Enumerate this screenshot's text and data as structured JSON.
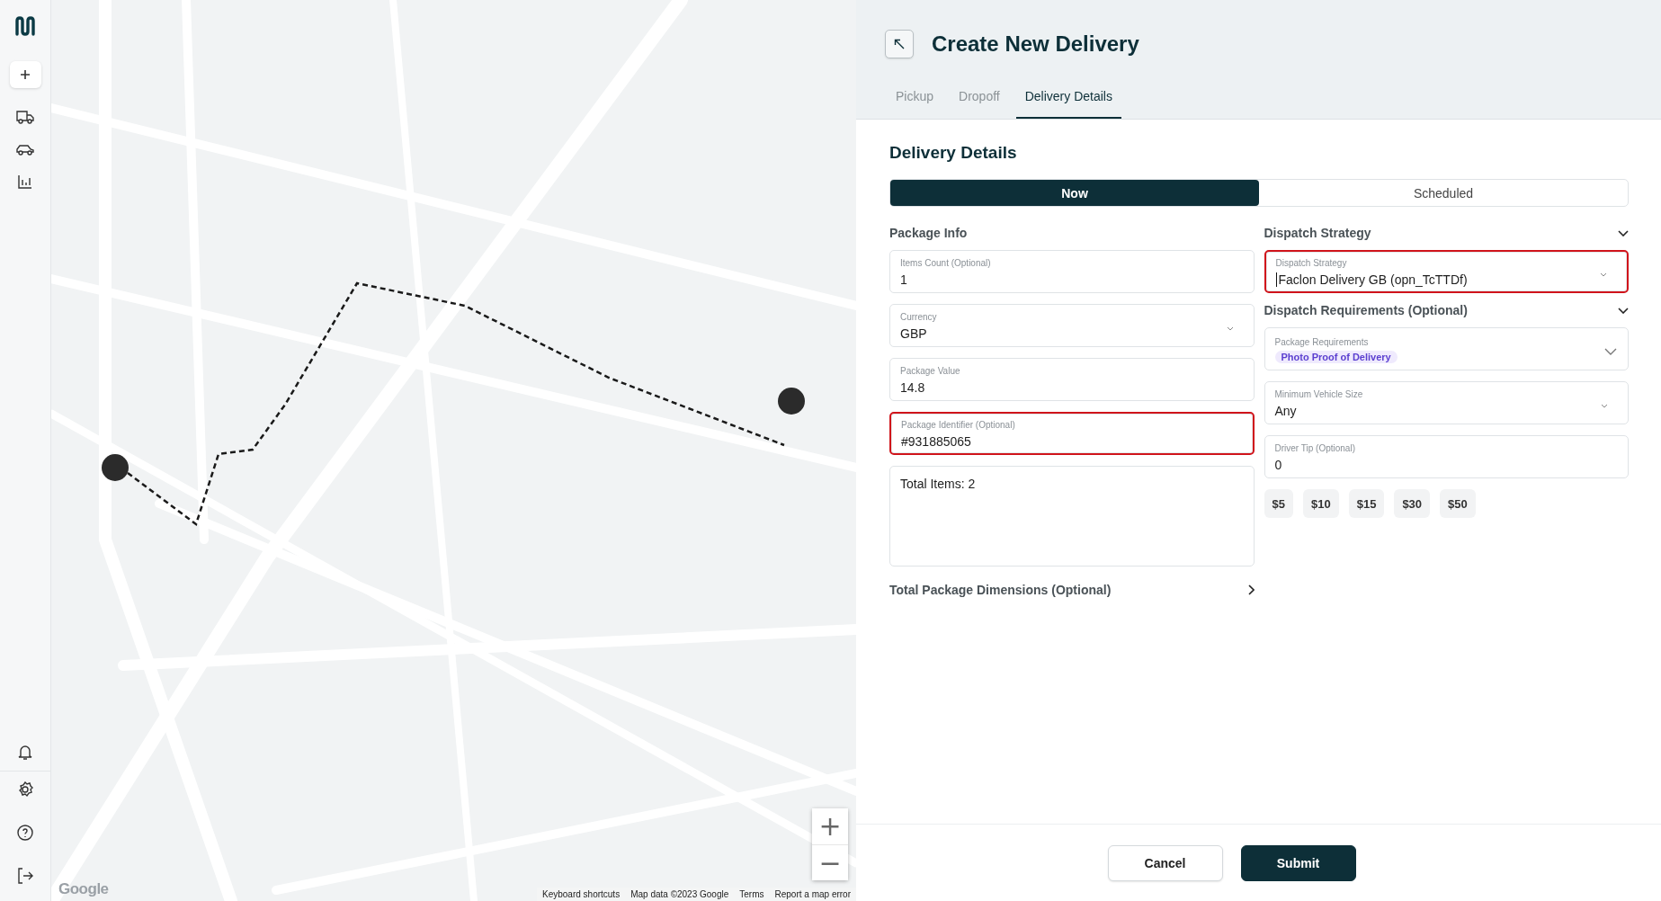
{
  "map": {
    "zoom_in": "+",
    "zoom_out": "−",
    "logo": "Google",
    "footer_links": [
      "Keyboard shortcuts",
      "Map data ©2023 Google",
      "Terms",
      "Report a map error"
    ]
  },
  "panel": {
    "title": "Create New Delivery",
    "tabs": [
      {
        "label": "Pickup",
        "selected": false
      },
      {
        "label": "Dropoff",
        "selected": false
      },
      {
        "label": "Delivery Details",
        "selected": true
      }
    ],
    "section_title": "Delivery Details",
    "timing": [
      {
        "label": "Now",
        "selected": true
      },
      {
        "label": "Scheduled",
        "selected": false
      }
    ],
    "left": {
      "heading": "Package Info",
      "fields": [
        {
          "kind": "text",
          "label": "Items Count (Optional)",
          "value": "1",
          "highlighted": false,
          "focused": false
        },
        {
          "kind": "select",
          "label": "Currency",
          "value": "GBP",
          "highlighted": false,
          "focused": false
        },
        {
          "kind": "text",
          "label": "Package Value",
          "value": "14.8",
          "highlighted": false,
          "focused": false
        },
        {
          "kind": "text",
          "label": "Package Identifier (Optional)",
          "value": "#931885065",
          "highlighted": true,
          "focused": false
        },
        {
          "kind": "textarea",
          "value": "Total Items: 2",
          "highlighted": false,
          "focused": false
        }
      ],
      "dimensions": {
        "label": "Total Package Dimensions (Optional)",
        "expanded": false
      }
    },
    "right": {
      "sections": [
        {
          "title": "Dispatch Strategy",
          "expanded": true,
          "fields": [
            {
              "kind": "select",
              "label": "Dispatch Strategy",
              "value": "Faclon Delivery GB (opn_TcTTDf)",
              "highlighted": true,
              "focused": true
            }
          ]
        },
        {
          "title": "Dispatch Requirements (Optional)",
          "expanded": true,
          "fields": [
            {
              "kind": "tags",
              "label": "Package Requirements",
              "tags": [
                "Photo Proof of Delivery"
              ],
              "highlighted": false,
              "focused": false
            },
            {
              "kind": "select",
              "label": "Minimum Vehicle Size",
              "value": "Any",
              "highlighted": false,
              "focused": false
            },
            {
              "kind": "text",
              "label": "Driver Tip (Optional)",
              "value": "0",
              "highlighted": false,
              "focused": false
            }
          ]
        }
      ],
      "tips": [
        "$5",
        "$10",
        "$15",
        "$30",
        "$50"
      ]
    },
    "buttons": [
      {
        "label": "Cancel",
        "kind": "secondary"
      },
      {
        "label": "Submit",
        "kind": "primary"
      }
    ]
  }
}
